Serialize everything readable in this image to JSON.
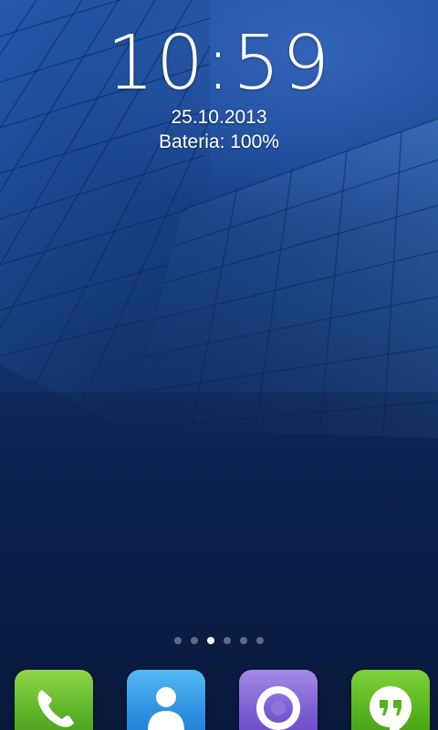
{
  "lockscreen": {
    "time": "10:59",
    "date": "25.10.2013",
    "battery": "Bateria: 100%"
  },
  "pager": {
    "dot_count": 6,
    "active_index": 2
  },
  "dock": {
    "apps": [
      {
        "name": "phone",
        "icon": "phone-icon",
        "color": "#5cb227"
      },
      {
        "name": "contacts",
        "icon": "contacts-icon",
        "color": "#2c8fe0"
      },
      {
        "name": "browser",
        "icon": "browser-icon",
        "color": "#7a5bd1"
      },
      {
        "name": "hangouts",
        "icon": "hangouts-icon",
        "color": "#55b21d"
      }
    ]
  },
  "colors": {
    "wallpaper_top": "#1c4fa0",
    "wallpaper_bottom": "#0a1a3c"
  }
}
